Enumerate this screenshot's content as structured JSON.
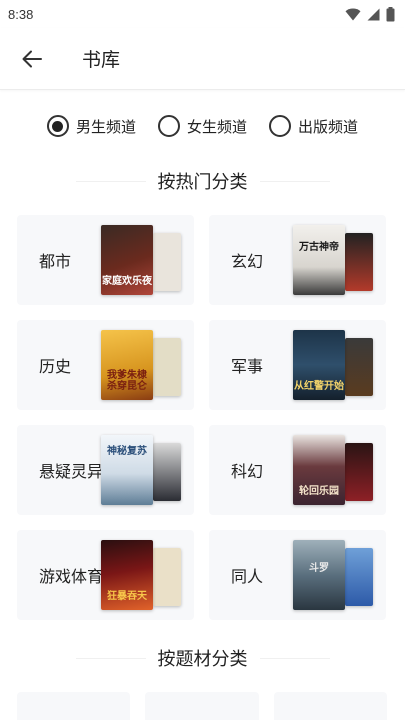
{
  "status_bar": {
    "time": "8:38"
  },
  "app_bar": {
    "title": "书库"
  },
  "channels": [
    {
      "label": "男生频道",
      "checked": true
    },
    {
      "label": "女生频道",
      "checked": false
    },
    {
      "label": "出版频道",
      "checked": false
    }
  ],
  "section_hot": {
    "title": "按热门分类"
  },
  "categories": [
    {
      "label": "都市",
      "cover_text": "家庭欢乐夜",
      "front_color": "#6b2a1e",
      "back_color": "#e9e4dc",
      "text_color": "#ffffff"
    },
    {
      "label": "玄幻",
      "cover_text": "万古神帝",
      "front_color": "#e8e6e1",
      "back_color": "#b33a2a",
      "text_color": "#1a1a1a"
    },
    {
      "label": "历史",
      "cover_text": "我爹朱棣杀穿昆仑",
      "front_color": "#d7951f",
      "back_color": "#e3ddc6",
      "text_color": "#7a1f10"
    },
    {
      "label": "军事",
      "cover_text": "从红警开始",
      "front_color": "#2f4f6b",
      "back_color": "#5a3b1f",
      "text_color": "#f2d36a"
    },
    {
      "label": "悬疑灵异",
      "cover_text": "神秘复苏",
      "front_color": "#dfe8f0",
      "back_color": "#2a2c33",
      "text_color": "#2b4f7a"
    },
    {
      "label": "科幻",
      "cover_text": "轮回乐园",
      "front_color": "#3b2430",
      "back_color": "#8e2026",
      "text_color": "#f3e3c9"
    },
    {
      "label": "游戏体育",
      "cover_text": "狂暴吞天",
      "front_color": "#7a1616",
      "back_color": "#eae0c8",
      "text_color": "#f7c64a"
    },
    {
      "label": "同人",
      "cover_text": "斗罗",
      "front_color": "#5a6f7e",
      "back_color": "#2d5aa8",
      "text_color": "#eaeaea"
    }
  ],
  "section_topic": {
    "title": "按题材分类"
  }
}
